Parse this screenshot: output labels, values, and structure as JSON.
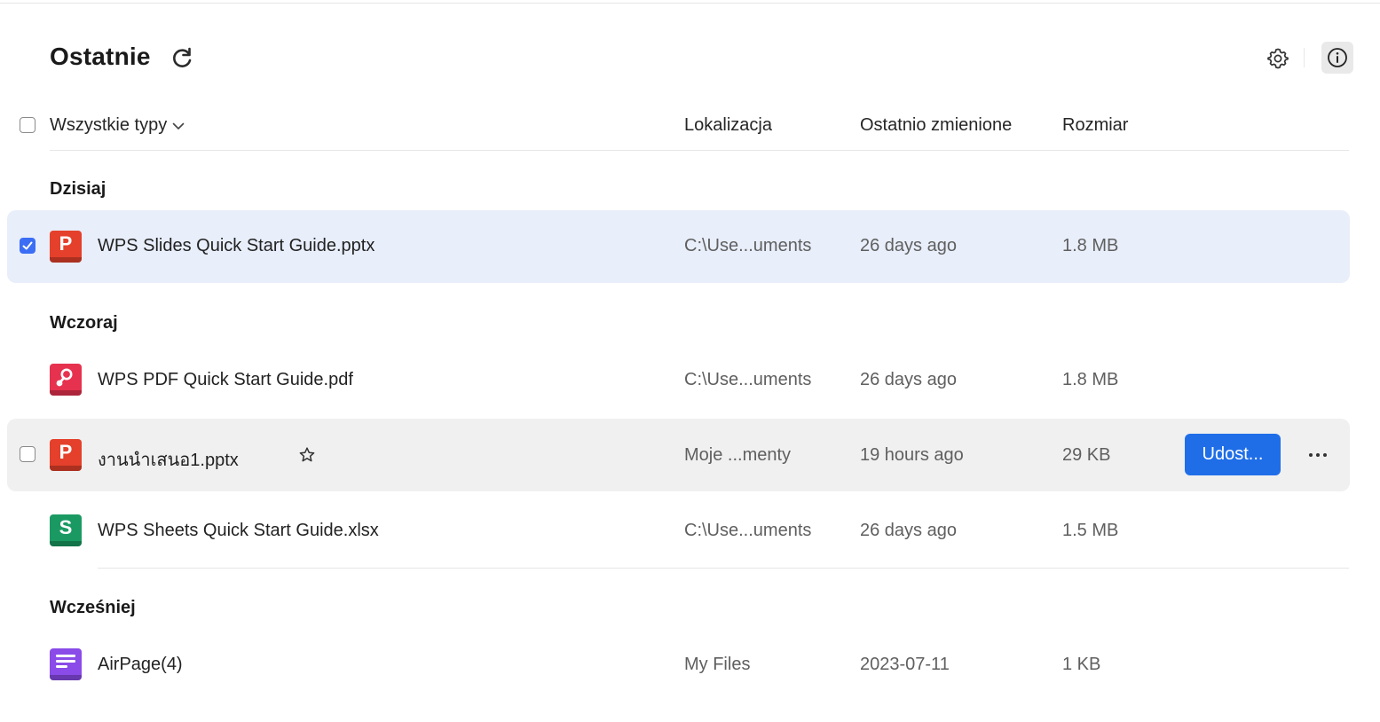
{
  "header": {
    "title": "Ostatnie",
    "refresh_icon": "refresh-icon",
    "settings_icon": "gear-icon",
    "info_icon": "info-icon"
  },
  "columns": {
    "type_filter": "Wszystkie typy",
    "location": "Lokalizacja",
    "modified": "Ostatnio zmienione",
    "size": "Rozmiar"
  },
  "sections": {
    "today": "Dzisiaj",
    "yesterday": "Wczoraj",
    "earlier": "Wcześniej"
  },
  "files": [
    {
      "name": "WPS Slides Quick Start Guide.pptx",
      "location": "C:\\Use...uments",
      "modified": "26 days ago",
      "size": "1.8 MB",
      "type": "presentation",
      "icon_letter": "P",
      "icon_color": "#e4402b",
      "checked": true
    },
    {
      "name": "WPS PDF Quick Start Guide.pdf",
      "location": "C:\\Use...uments",
      "modified": "26 days ago",
      "size": "1.8 MB",
      "type": "pdf",
      "icon_color": "#e6324f",
      "checked": false
    },
    {
      "name": "งานนำเสนอ1.pptx",
      "location": "Moje ...menty",
      "modified": "19 hours ago",
      "size": "29 KB",
      "type": "presentation",
      "icon_letter": "P",
      "icon_color": "#e4402b",
      "checked": false
    },
    {
      "name": "WPS Sheets Quick Start Guide.xlsx",
      "location": "C:\\Use...uments",
      "modified": "26 days ago",
      "size": "1.5 MB",
      "type": "spreadsheet",
      "icon_letter": "S",
      "icon_color": "#1a9a62",
      "checked": false
    },
    {
      "name": "AirPage(4)",
      "location": "My Files",
      "modified": "2023-07-11",
      "size": "1 KB",
      "type": "airpage",
      "icon_color": "#8a4be8",
      "checked": false
    }
  ],
  "actions": {
    "share_label": "Udost...",
    "more_icon": "more-icon",
    "star_icon": "star-icon"
  },
  "colors": {
    "accent": "#1f6ee8",
    "selected_row": "#e8eefa",
    "hover_row": "#f0f0f0"
  }
}
